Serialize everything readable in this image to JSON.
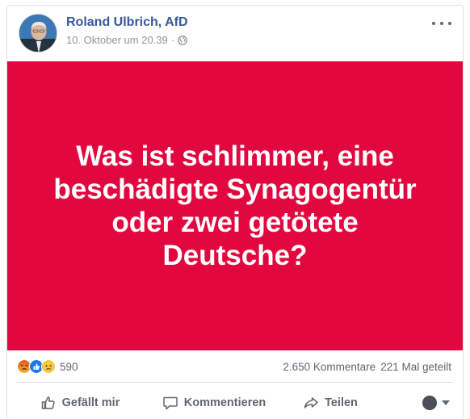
{
  "post": {
    "author": "Roland Ulbrich, AfD",
    "timestamp": "10. Oktober um 20.39",
    "separator": "·",
    "privacy_icon": "globe-icon",
    "image_text": "Was ist schlimmer, eine beschädigte Synagogentür oder zwei getötete Deutsche?",
    "image_background": "#e3073f"
  },
  "reactions": {
    "icons": [
      "angry-reaction-icon",
      "like-reaction-icon",
      "sad-reaction-icon"
    ],
    "count": "590"
  },
  "stats": {
    "comments": "2.650 Kommentare",
    "shares": "221 Mal geteilt"
  },
  "actions": {
    "like": "Gefällt mir",
    "comment": "Kommentieren",
    "share": "Teilen"
  },
  "colors": {
    "link": "#385898",
    "secondary_text": "#606770",
    "meta_text": "#90949c"
  }
}
